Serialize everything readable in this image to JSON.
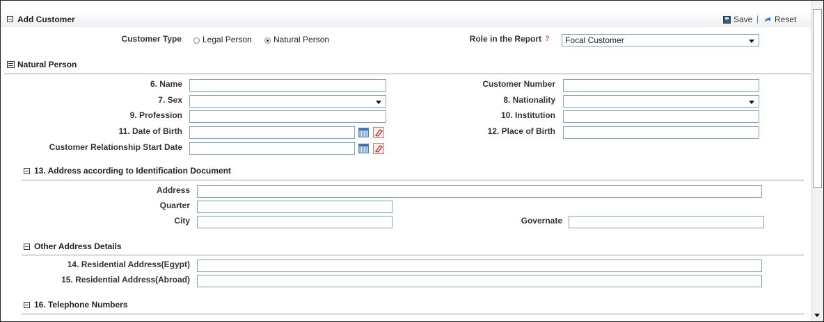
{
  "panel": {
    "title": "Add Customer",
    "save_label": "Save",
    "reset_label": "Reset",
    "separator": "|"
  },
  "customer_type": {
    "label": "Customer Type",
    "options": [
      "Legal Person",
      "Natural Person"
    ],
    "selected": "Natural Person"
  },
  "role": {
    "label": "Role in the Report",
    "help": "?",
    "value": "Focal Customer"
  },
  "natural_person": {
    "title": "Natural Person",
    "fields": {
      "name": {
        "label": "6. Name",
        "value": ""
      },
      "customer_number": {
        "label": "Customer Number",
        "value": ""
      },
      "sex": {
        "label": "7. Sex",
        "value": ""
      },
      "nationality": {
        "label": "8. Nationality",
        "value": ""
      },
      "profession": {
        "label": "9. Profession",
        "value": ""
      },
      "institution": {
        "label": "10. Institution",
        "value": ""
      },
      "dob": {
        "label": "11. Date of Birth",
        "value": ""
      },
      "place_of_birth": {
        "label": "12. Place of Birth",
        "value": ""
      },
      "relationship_start": {
        "label": "Customer Relationship Start Date",
        "value": ""
      }
    }
  },
  "address_section": {
    "title": "13. Address according to Identification Document",
    "address_label": "Address",
    "quarter_label": "Quarter",
    "city_label": "City",
    "governate_label": "Governate"
  },
  "other_address": {
    "title": "Other Address Details",
    "egypt_label": "14. Residential Address(Egypt)",
    "abroad_label": "15. Residential Address(Abroad)"
  },
  "telephone": {
    "title": "16. Telephone Numbers"
  },
  "icons": {
    "save": "floppy-icon",
    "reset": "reset-arrow-icon",
    "calendar": "calendar-icon",
    "clear": "eraser-icon"
  }
}
